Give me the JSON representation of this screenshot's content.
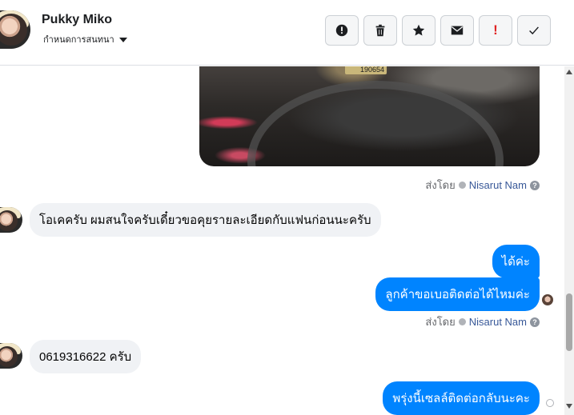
{
  "header": {
    "contact_name": "Pukky Miko",
    "assign_label": "กำหนดการสนทนา",
    "toolbar": [
      {
        "name": "spam-button",
        "icon": "alert-circle-icon"
      },
      {
        "name": "delete-button",
        "icon": "trash-icon"
      },
      {
        "name": "star-button",
        "icon": "star-icon"
      },
      {
        "name": "mark-unread-button",
        "icon": "envelope-icon"
      },
      {
        "name": "follow-up-button",
        "icon": "exclamation-icon",
        "text": "!"
      },
      {
        "name": "mark-done-button",
        "icon": "check-icon"
      }
    ]
  },
  "messages": {
    "sent_by_1": {
      "prefix": "ส่งโดย",
      "sender": "Nisarut Nam",
      "help": "?"
    },
    "incoming_1": "โอเคครับ ผมสนใจครับเดี๋ยวขอคุยรายละเอียดกับแฟนก่อนนะครับ",
    "outgoing_1": "ได้ค่ะ",
    "outgoing_2": "ลูกค้าขอเบอติดต่อได้ไหมค่ะ",
    "sent_by_2": {
      "prefix": "ส่งโดย",
      "sender": "Nisarut Nam",
      "help": "?"
    },
    "incoming_2": "0619316622 ครับ",
    "outgoing_3": "พรุ่งนี้เซลล์ติดต่อกลับนะคะ"
  },
  "photo": {
    "odometer": "190654"
  },
  "colors": {
    "outgoing_bubble": "#0084ff",
    "incoming_bubble": "#f0f2f5",
    "sender_link": "#385898",
    "flag": "#e02424"
  }
}
